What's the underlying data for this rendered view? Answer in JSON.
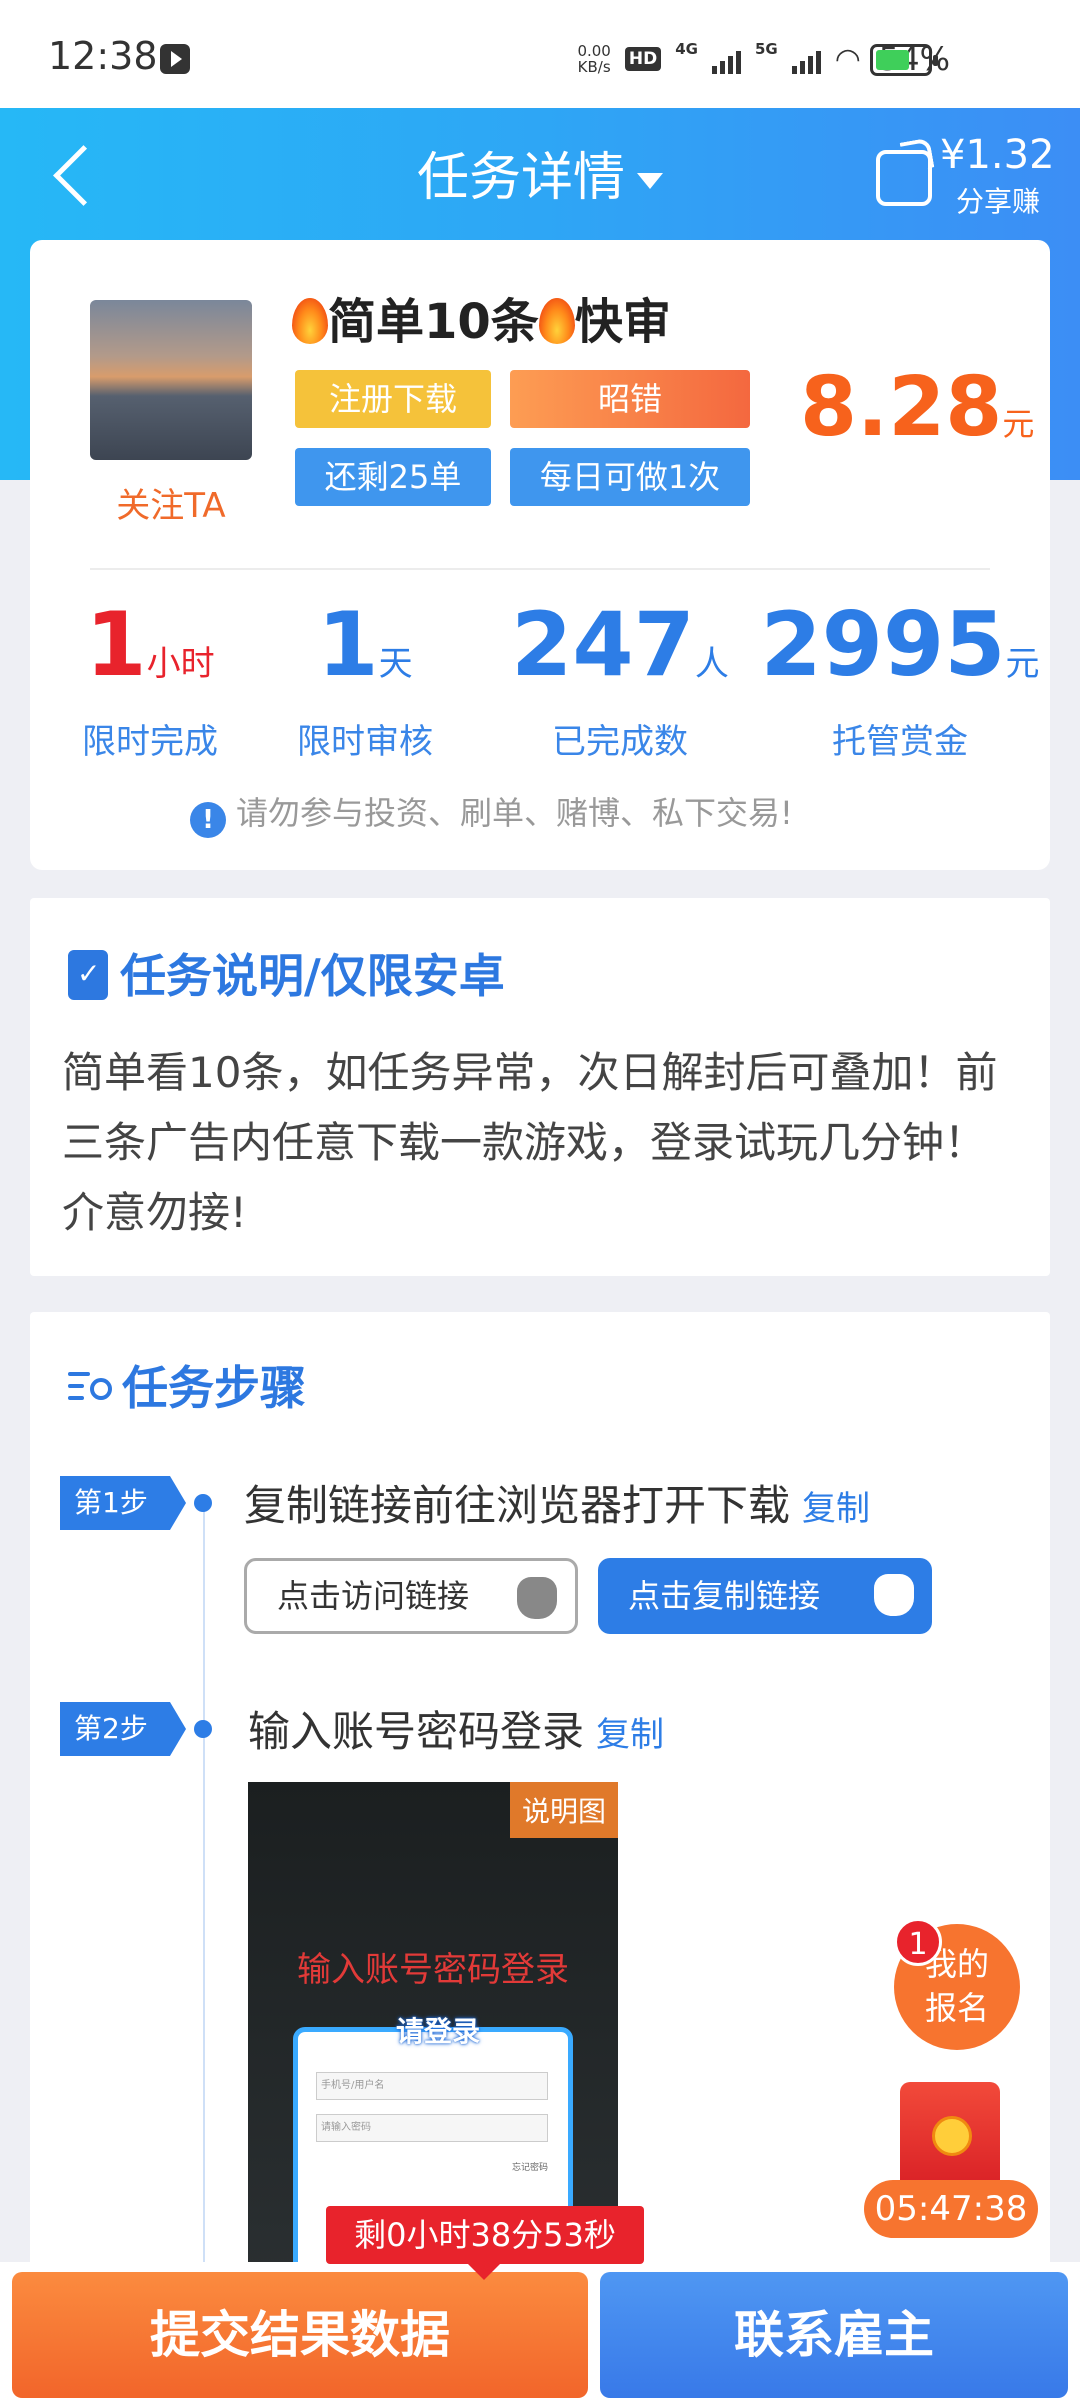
{
  "status_bar": {
    "time": "12:38",
    "net_speed": "0.00",
    "net_unit": "KB/s",
    "hd": "HD",
    "net1": "4G",
    "net2": "5G",
    "battery": "54%"
  },
  "header": {
    "title": "任务详情",
    "share_amount": "¥1.32",
    "share_label": "分享赚"
  },
  "task": {
    "follow_label": "关注TA",
    "title": "简单10条",
    "title_suffix": "快审",
    "tags": [
      "注册下载",
      "昭错",
      "还剩25单",
      "每日可做1次"
    ],
    "price": "8.28",
    "price_unit": "元",
    "stats": [
      {
        "value": "1",
        "unit": "小时",
        "label": "限时完成"
      },
      {
        "value": "1",
        "unit": "天",
        "label": "限时审核"
      },
      {
        "value": "247",
        "unit": "人",
        "label": "已完成数"
      },
      {
        "value": "2995",
        "unit": "元",
        "label": "托管赏金"
      }
    ],
    "warning": "请勿参与投资、刷单、赌博、私下交易!"
  },
  "description": {
    "title": "任务说明/仅限安卓",
    "text": "简单看10条，如任务异常，次日解封后可叠加！前三条广告内任意下载一款游戏，登录试玩几分钟！介意勿接!"
  },
  "steps": {
    "title": "任务步骤",
    "items": [
      {
        "badge": "第1步",
        "text": "复制链接前往浏览器打开下载",
        "copy": "复制",
        "btn_visit": "点击访问链接",
        "btn_copy": "点击复制链接"
      },
      {
        "badge": "第2步",
        "text": "输入账号密码登录",
        "copy": "复制"
      }
    ],
    "demo": {
      "tag": "说明图",
      "heading": "输入账号密码登录",
      "box_title": "请登录",
      "field1": "手机号/用户名",
      "field2": "请输入密码",
      "forgot": "忘记密码"
    }
  },
  "floating": {
    "badge": "1",
    "signup_line1": "我的",
    "signup_line2": "报名",
    "timer": "05:47:38"
  },
  "bottom": {
    "countdown": "剩0小时38分53秒",
    "submit": "提交结果数据",
    "contact": "联系雇主"
  }
}
